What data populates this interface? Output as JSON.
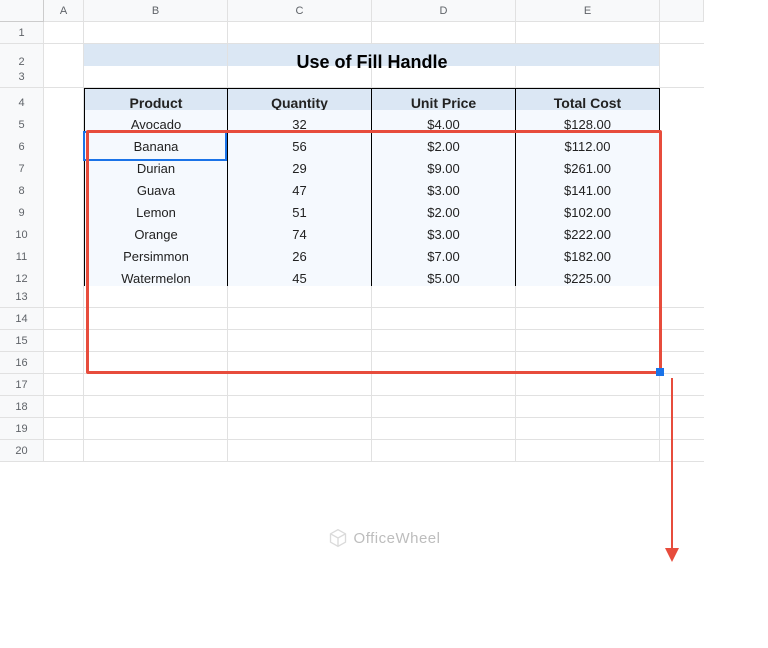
{
  "columns": [
    "A",
    "B",
    "C",
    "D",
    "E"
  ],
  "row_count": 20,
  "title": "Use of Fill Handle",
  "table": {
    "headers": [
      "Product",
      "Quantity",
      "Unit Price",
      "Total Cost"
    ],
    "rows": [
      {
        "product": "Avocado",
        "qty": "32",
        "price": "$4.00",
        "total": "$128.00"
      },
      {
        "product": "Banana",
        "qty": "56",
        "price": "$2.00",
        "total": "$112.00"
      },
      {
        "product": "Durian",
        "qty": "29",
        "price": "$9.00",
        "total": "$261.00"
      },
      {
        "product": "Guava",
        "qty": "47",
        "price": "$3.00",
        "total": "$141.00"
      },
      {
        "product": "Lemon",
        "qty": "51",
        "price": "$2.00",
        "total": "$102.00"
      },
      {
        "product": "Orange",
        "qty": "74",
        "price": "$3.00",
        "total": "$222.00"
      },
      {
        "product": "Persimmon",
        "qty": "26",
        "price": "$7.00",
        "total": "$182.00"
      },
      {
        "product": "Watermelon",
        "qty": "45",
        "price": "$5.00",
        "total": "$225.00"
      }
    ]
  },
  "watermark": "OfficeWheel",
  "chart_data": {
    "type": "table",
    "title": "Use of Fill Handle",
    "columns": [
      "Product",
      "Quantity",
      "Unit Price",
      "Total Cost"
    ],
    "rows": [
      [
        "Avocado",
        32,
        4.0,
        128.0
      ],
      [
        "Banana",
        56,
        2.0,
        112.0
      ],
      [
        "Durian",
        29,
        9.0,
        261.0
      ],
      [
        "Guava",
        47,
        3.0,
        141.0
      ],
      [
        "Lemon",
        51,
        2.0,
        102.0
      ],
      [
        "Orange",
        74,
        3.0,
        222.0
      ],
      [
        "Persimmon",
        26,
        7.0,
        182.0
      ],
      [
        "Watermelon",
        45,
        5.0,
        225.0
      ]
    ]
  }
}
